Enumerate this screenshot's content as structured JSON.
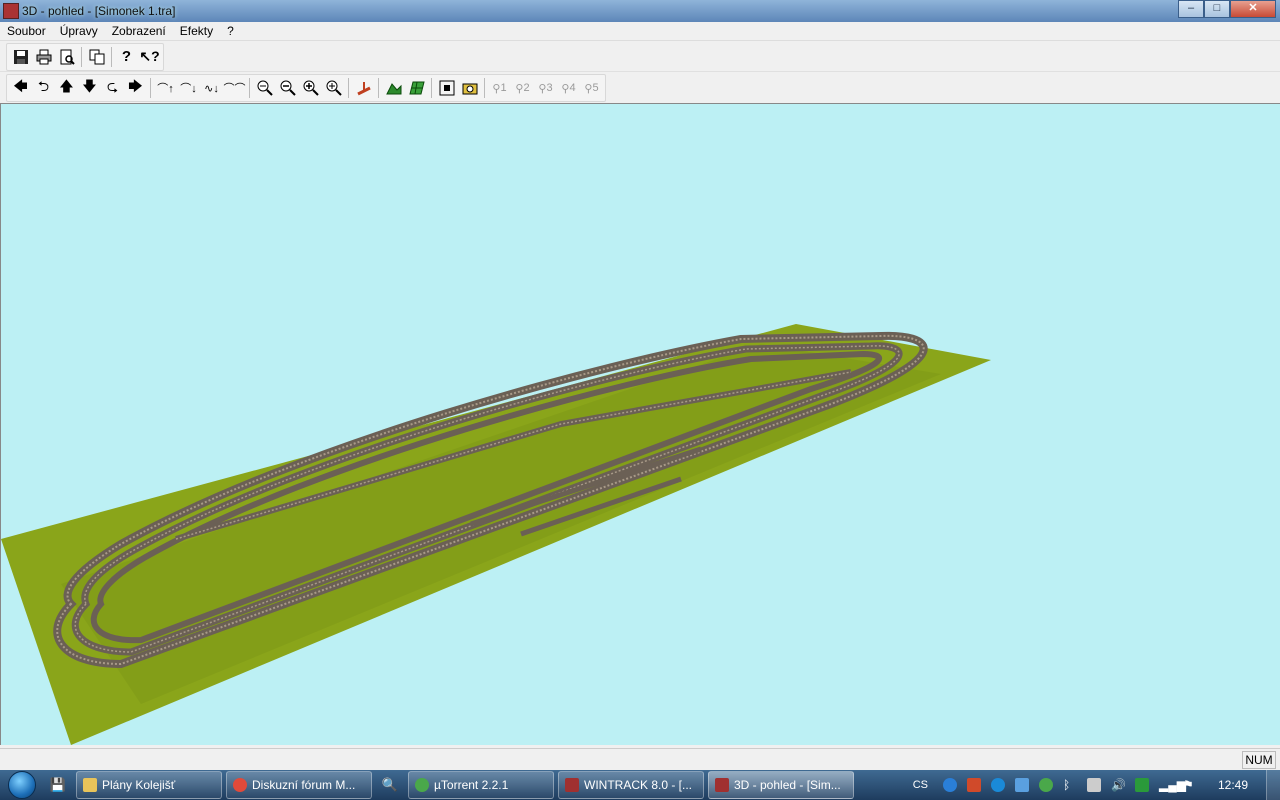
{
  "window": {
    "title": "3D - pohled - [Simonek 1.tra]",
    "minimize": "–",
    "maximize": "□",
    "close": "✕"
  },
  "menu": [
    "Soubor",
    "Úpravy",
    "Zobrazení",
    "Efekty",
    "?"
  ],
  "toolbar1": {
    "icons": [
      "save-icon",
      "print-icon",
      "print-preview-icon",
      "copy-icon",
      "help-icon",
      "context-help-icon"
    ]
  },
  "toolbar2": {
    "icons": [
      "arrow-left-icon",
      "arrow-rotate-left-icon",
      "arrow-up-icon",
      "arrow-down-icon",
      "arrow-rotate-right-icon",
      "arrow-right-icon",
      "view-tilt-up-icon",
      "view-tilt-down-icon",
      "view-lower-icon",
      "view-raise-icon",
      "zoom-out-all-icon",
      "zoom-out-icon",
      "zoom-in-icon",
      "zoom-in-all-icon",
      "track-icon",
      "terrain-icon",
      "grid-icon",
      "fit-view-icon",
      "camera-icon"
    ],
    "camera_presets": [
      "1",
      "2",
      "3",
      "4",
      "5"
    ]
  },
  "viewport": {
    "sky_color": "#bcf0f4",
    "ground_color": "#8aa51a",
    "track_color": "#6b6055"
  },
  "status": {
    "num": "NUM"
  },
  "taskbar": {
    "tasks": [
      {
        "label": "Plány Kolejišť",
        "icon_color": "#e8c35a"
      },
      {
        "label": "Diskuzní fórum M...",
        "icon_color": "#e04a3a"
      },
      {
        "label": "µTorrent 2.2.1",
        "icon_color": "#4aa84a"
      },
      {
        "label": "WINTRACK 8.0 - [...",
        "icon_color": "#a03030"
      },
      {
        "label": "3D - pohled - [Sim...",
        "icon_color": "#a03030"
      }
    ],
    "lang": "CS",
    "time": "12:49"
  }
}
